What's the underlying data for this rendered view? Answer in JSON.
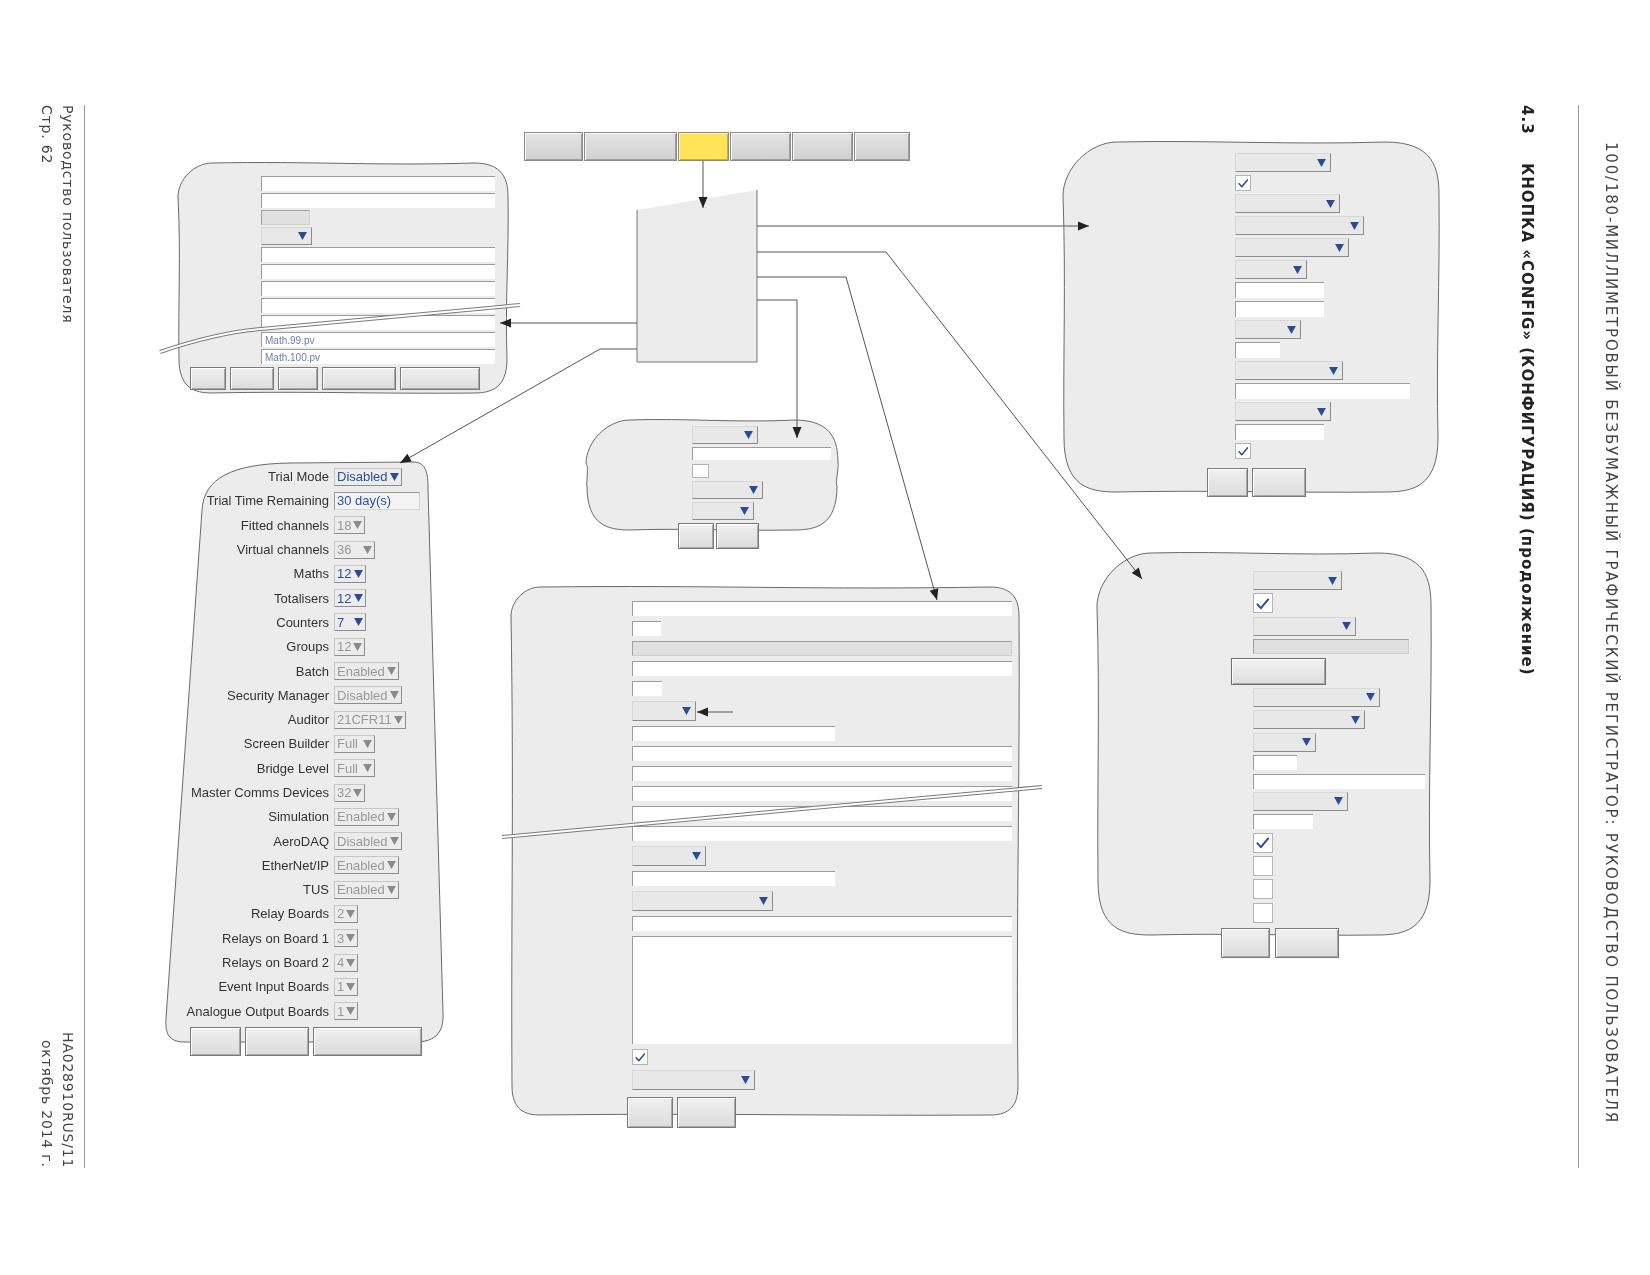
{
  "page_header": {
    "section_number": "4.3",
    "section_title": "КНОПКА «CONFIG» (КОНФИГУРАЦИЯ) (продолжение)",
    "running_title": "100/180-МИЛЛИМЕТРОВЫЙ БЕЗБУМАЖНЫЙ ГРАФИЧЕСКИЙ РЕГИСТРАТОР: РУКОВОДСТВО ПОЛЬЗОВАТЕЛЯ"
  },
  "page_footer": {
    "document_title": "Руководство пользователя",
    "page_number": "Стр. 62",
    "document_number": "HA028910RUS/11",
    "date": "октябрь 2014 г."
  },
  "toolbar": {
    "buttons": [
      {
        "selected": false
      },
      {
        "selected": false
      },
      {
        "selected": true
      },
      {
        "selected": false
      },
      {
        "selected": false
      },
      {
        "selected": false
      }
    ]
  },
  "top_left_panel": {
    "fields": [
      {
        "kind": "text"
      },
      {
        "kind": "text"
      },
      {
        "kind": "readonly"
      },
      {
        "kind": "dropdown"
      },
      {
        "kind": "text"
      },
      {
        "kind": "text"
      },
      {
        "kind": "text"
      },
      {
        "kind": "text"
      },
      {
        "kind": "text"
      },
      {
        "kind": "text",
        "value": "Math.99.pv"
      },
      {
        "kind": "text",
        "value": "Math.100.pv"
      }
    ]
  },
  "options_panel": {
    "rows": [
      {
        "label": "Trial Mode",
        "value": "Disabled",
        "kind": "dropdown",
        "disabled": false
      },
      {
        "label": "Trial Time Remaining",
        "value": "30 day(s)",
        "kind": "text",
        "disabled": false
      },
      {
        "label": "Fitted channels",
        "value": "18",
        "kind": "dropdown",
        "disabled": true
      },
      {
        "label": "Virtual channels",
        "value": "36",
        "kind": "dropdown",
        "disabled": true
      },
      {
        "label": "Maths",
        "value": "12",
        "kind": "dropdown",
        "disabled": false
      },
      {
        "label": "Totalisers",
        "value": "12",
        "kind": "dropdown",
        "disabled": false
      },
      {
        "label": "Counters",
        "value": "7",
        "kind": "dropdown",
        "disabled": false
      },
      {
        "label": "Groups",
        "value": "12",
        "kind": "dropdown",
        "disabled": true
      },
      {
        "label": "Batch",
        "value": "Enabled",
        "kind": "dropdown",
        "disabled": true
      },
      {
        "label": "Security Manager",
        "value": "Disabled",
        "kind": "dropdown",
        "disabled": true
      },
      {
        "label": "Auditor",
        "value": "21CFR11",
        "kind": "dropdown",
        "disabled": true
      },
      {
        "label": "Screen Builder",
        "value": "Full",
        "kind": "dropdown",
        "disabled": true
      },
      {
        "label": "Bridge Level",
        "value": "Full",
        "kind": "dropdown",
        "disabled": true
      },
      {
        "label": "Master Comms Devices",
        "value": "32",
        "kind": "dropdown",
        "disabled": true
      },
      {
        "label": "Simulation",
        "value": "Enabled",
        "kind": "dropdown",
        "disabled": true
      },
      {
        "label": "AeroDAQ",
        "value": "Disabled",
        "kind": "dropdown",
        "disabled": true
      },
      {
        "label": "EtherNet/IP",
        "value": "Enabled",
        "kind": "dropdown",
        "disabled": true
      },
      {
        "label": "TUS",
        "value": "Enabled",
        "kind": "dropdown",
        "disabled": true
      },
      {
        "label": "Relay Boards",
        "value": "2",
        "kind": "dropdown",
        "disabled": true
      },
      {
        "label": "Relays on Board 1",
        "value": "3",
        "kind": "dropdown",
        "disabled": true
      },
      {
        "label": "Relays on Board 2",
        "value": "4",
        "kind": "dropdown",
        "disabled": true
      },
      {
        "label": "Event Input Boards",
        "value": "1",
        "kind": "dropdown",
        "disabled": true
      },
      {
        "label": "Analogue Output Boards",
        "value": "1",
        "kind": "dropdown",
        "disabled": true
      }
    ]
  },
  "center_panel": {
    "fields": [
      {
        "kind": "dropdown"
      },
      {
        "kind": "text"
      },
      {
        "kind": "checkbox",
        "checked": false
      },
      {
        "kind": "dropdown"
      },
      {
        "kind": "dropdown"
      }
    ]
  },
  "bottom_panel": {
    "fields": [
      {
        "kind": "text"
      },
      {
        "kind": "text"
      },
      {
        "kind": "readonly"
      },
      {
        "kind": "text"
      },
      {
        "kind": "text"
      },
      {
        "kind": "dropdown"
      },
      {
        "kind": "text"
      },
      {
        "kind": "text"
      },
      {
        "kind": "text"
      },
      {
        "kind": "text"
      },
      {
        "kind": "text"
      },
      {
        "kind": "text"
      },
      {
        "kind": "dropdown"
      },
      {
        "kind": "text"
      },
      {
        "kind": "dropdown"
      },
      {
        "kind": "text"
      },
      {
        "kind": "textarea"
      },
      {
        "kind": "checkbox",
        "checked": true
      },
      {
        "kind": "dropdown"
      }
    ]
  },
  "top_right_panel": {
    "fields": [
      {
        "kind": "dropdown"
      },
      {
        "kind": "checkbox",
        "checked": true
      },
      {
        "kind": "dropdown"
      },
      {
        "kind": "dropdown"
      },
      {
        "kind": "dropdown"
      },
      {
        "kind": "dropdown"
      },
      {
        "kind": "text"
      },
      {
        "kind": "text"
      },
      {
        "kind": "dropdown"
      },
      {
        "kind": "text"
      },
      {
        "kind": "dropdown"
      },
      {
        "kind": "text"
      },
      {
        "kind": "dropdown"
      },
      {
        "kind": "text"
      },
      {
        "kind": "checkbox",
        "checked": true
      }
    ]
  },
  "bottom_right_panel": {
    "fields": [
      {
        "kind": "dropdown"
      },
      {
        "kind": "checkbox",
        "checked": true
      },
      {
        "kind": "dropdown"
      },
      {
        "kind": "readonly"
      },
      {
        "kind": "button"
      },
      {
        "kind": "dropdown"
      },
      {
        "kind": "dropdown"
      },
      {
        "kind": "dropdown"
      },
      {
        "kind": "text"
      },
      {
        "kind": "text"
      },
      {
        "kind": "dropdown"
      },
      {
        "kind": "text"
      },
      {
        "kind": "checkbox",
        "checked": true
      },
      {
        "kind": "checkbox",
        "checked": false
      },
      {
        "kind": "checkbox",
        "checked": false
      },
      {
        "kind": "checkbox",
        "checked": false
      }
    ]
  }
}
